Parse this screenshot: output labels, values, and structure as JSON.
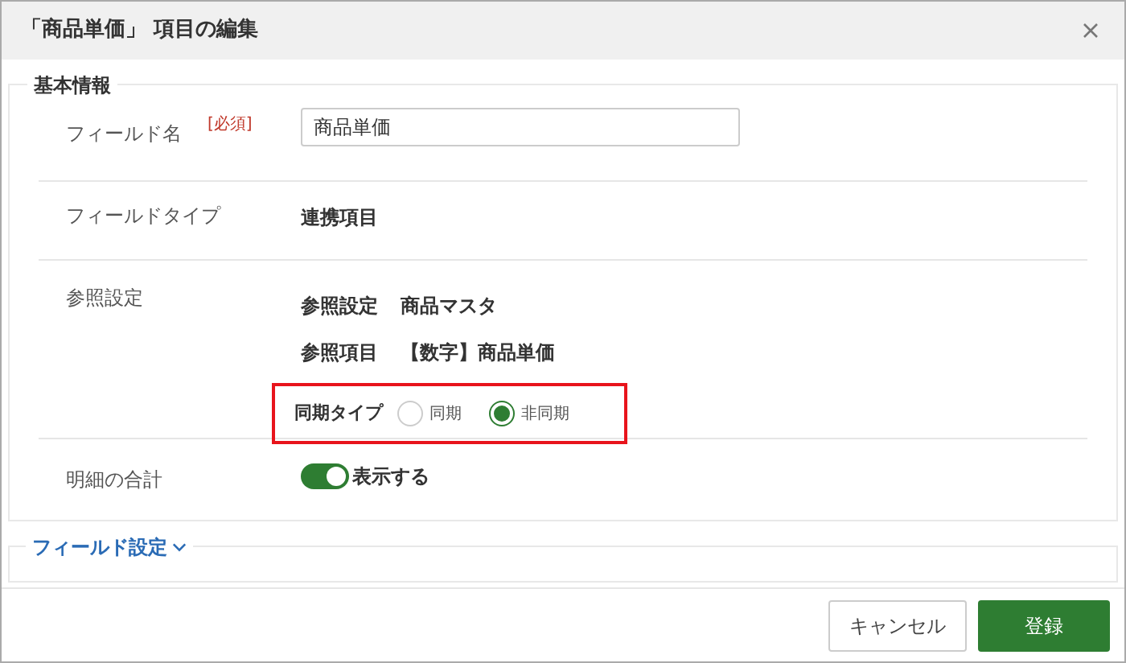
{
  "dialog": {
    "title": "「商品単価」 項目の編集"
  },
  "basic_section": {
    "legend": "基本情報",
    "field_name": {
      "label": "フィールド名",
      "required": "[必須]",
      "value": "商品単価"
    },
    "field_type": {
      "label": "フィールドタイプ",
      "value": "連携項目"
    },
    "reference": {
      "label": "参照設定",
      "lines": [
        {
          "label": "参照設定",
          "value": "商品マスタ"
        },
        {
          "label": "参照項目",
          "value": "【数字】商品単価"
        }
      ],
      "sync_type": {
        "label": "同期タイプ",
        "highlighted": true,
        "options": [
          {
            "label": "同期",
            "selected": false
          },
          {
            "label": "非同期",
            "selected": true
          }
        ]
      }
    },
    "detail_total": {
      "label": "明細の合計",
      "on": true,
      "toggle_label": "表示する"
    }
  },
  "field_settings": {
    "legend": "フィールド設定",
    "expanded": false
  },
  "buttons": [
    {
      "kind": "secondary",
      "label": "キャンセル"
    },
    {
      "kind": "primary",
      "label": "登録"
    }
  ]
}
